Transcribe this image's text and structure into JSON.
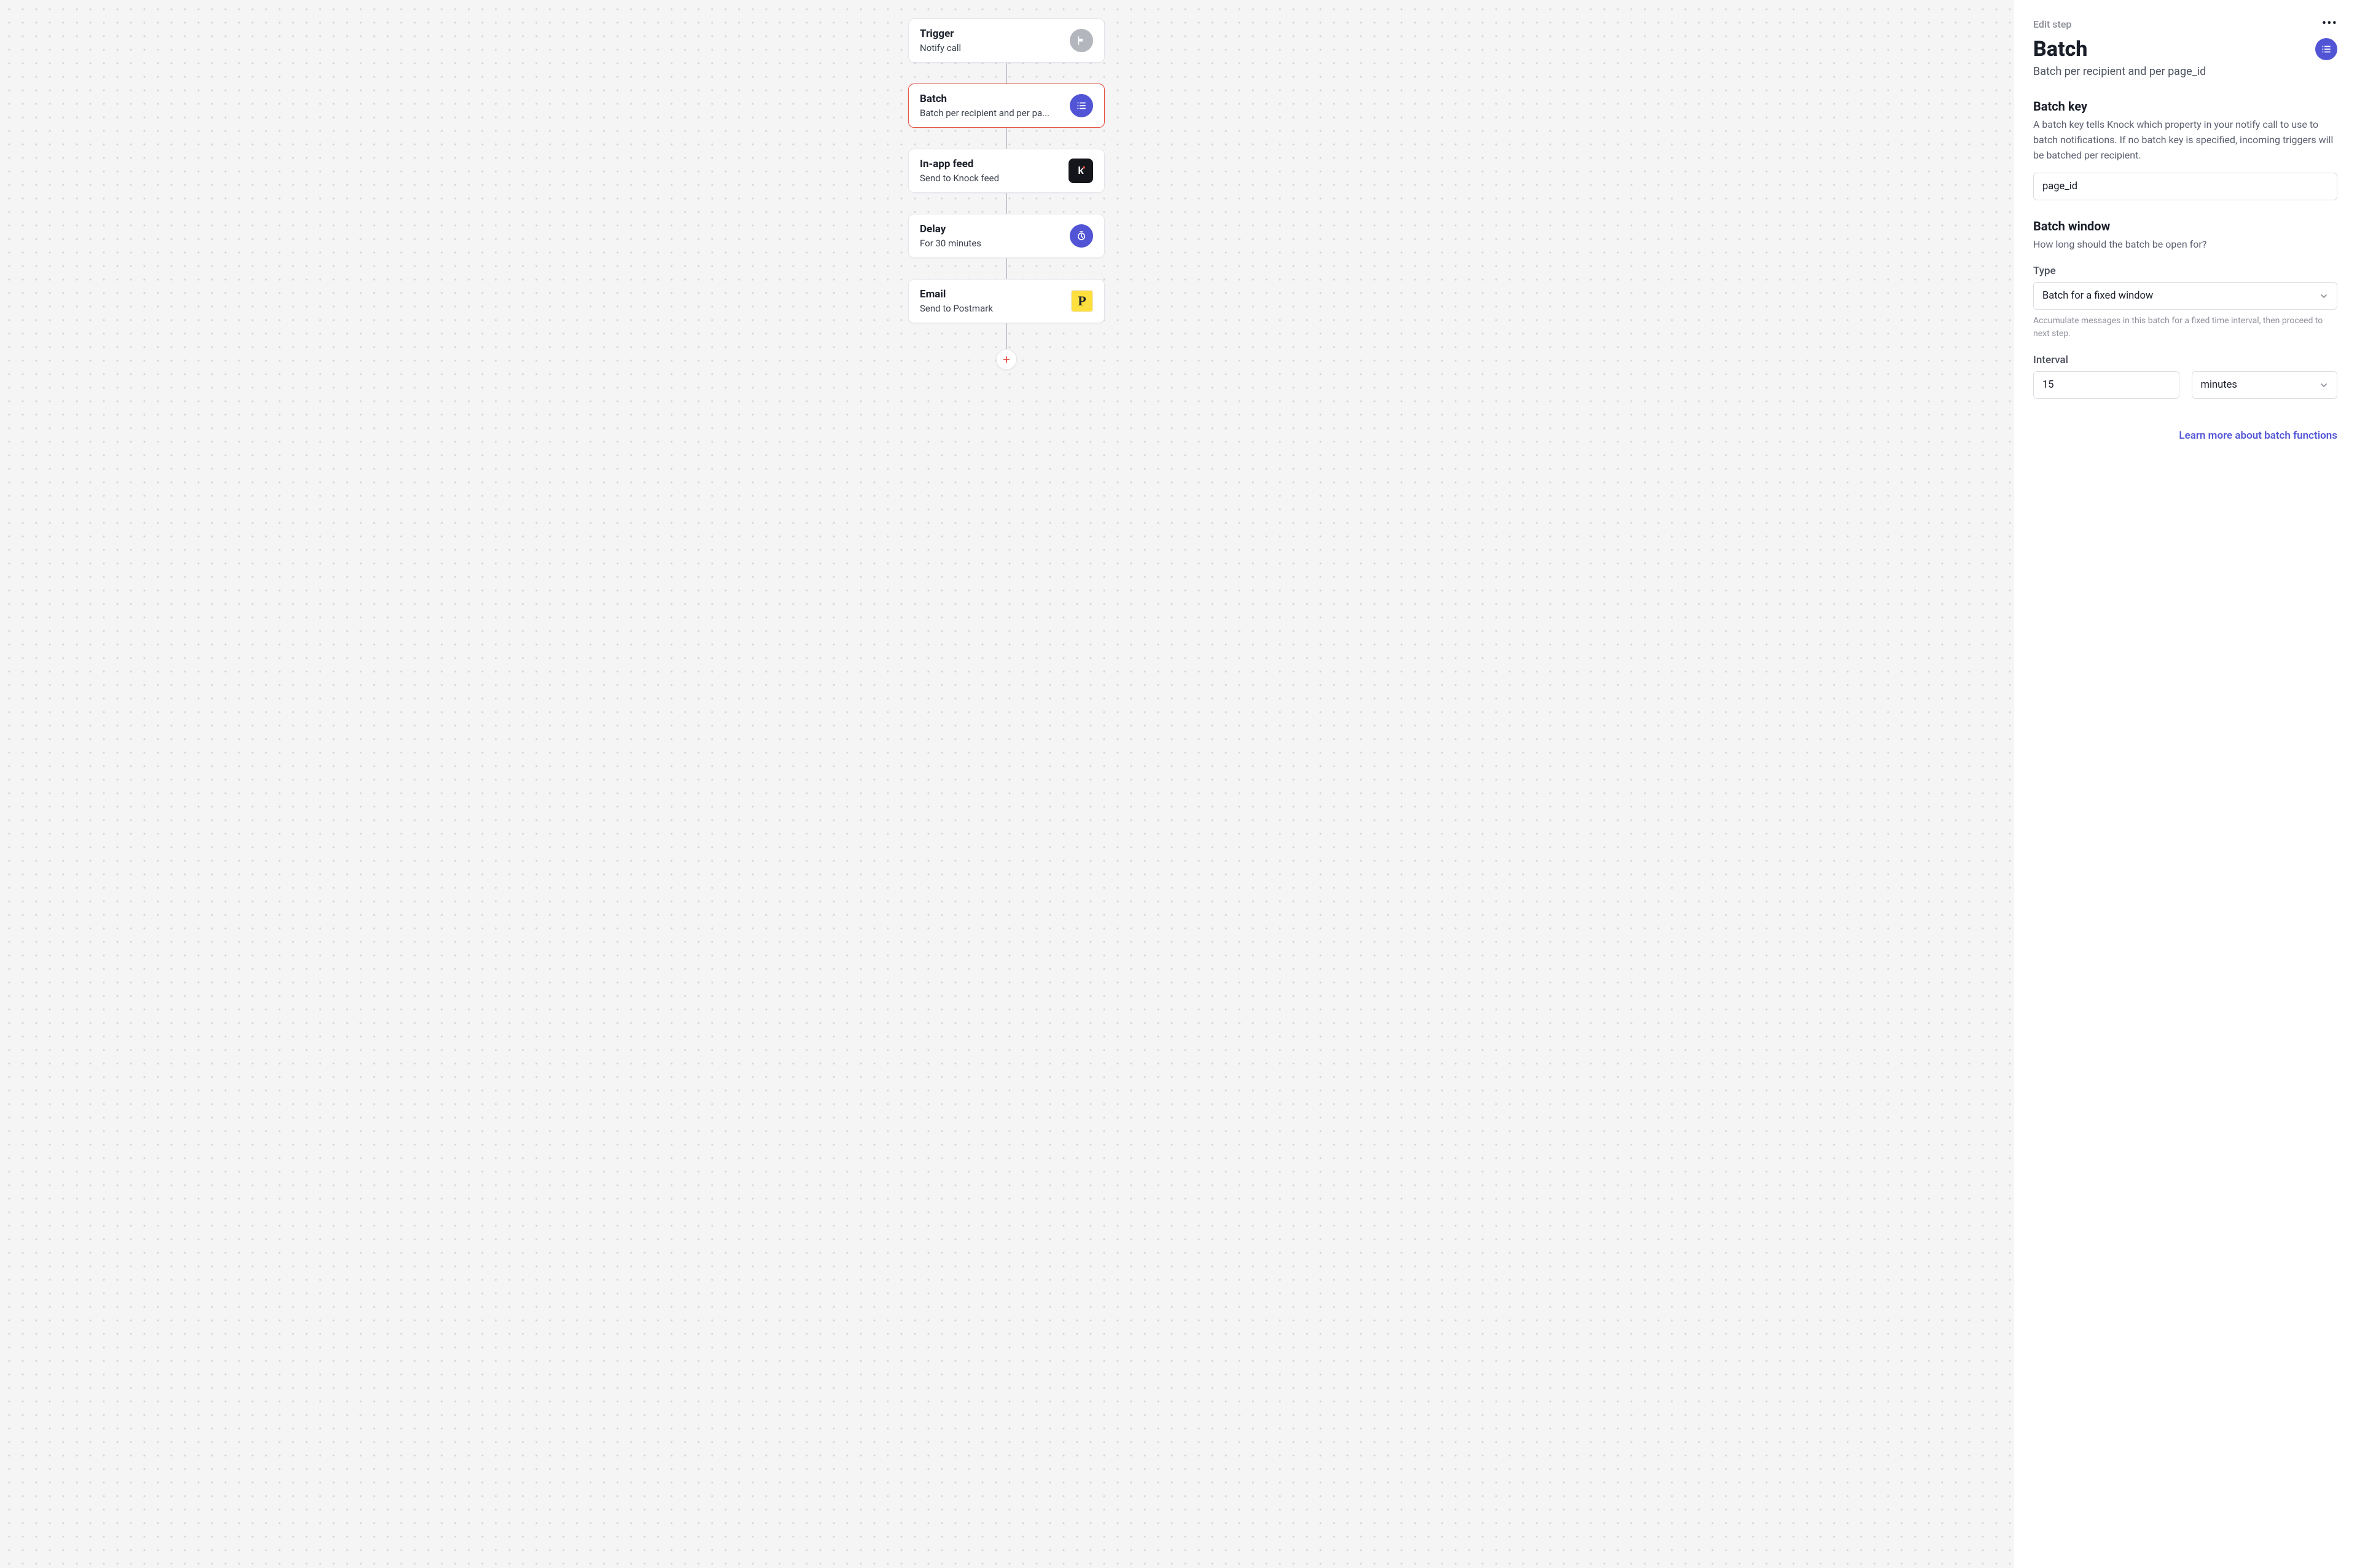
{
  "flow": {
    "nodes": [
      {
        "title": "Trigger",
        "subtitle": "Notify call",
        "icon": "flag",
        "selected": false
      },
      {
        "title": "Batch",
        "subtitle": "Batch per recipient and per pa...",
        "icon": "list",
        "selected": true
      },
      {
        "title": "In-app feed",
        "subtitle": "Send to Knock feed",
        "icon": "knock",
        "selected": false
      },
      {
        "title": "Delay",
        "subtitle": "For 30 minutes",
        "icon": "clock",
        "selected": false
      },
      {
        "title": "Email",
        "subtitle": "Send to Postmark",
        "icon": "postmark",
        "selected": false
      }
    ],
    "add_label": "+"
  },
  "panel": {
    "breadcrumb": "Edit step",
    "title": "Batch",
    "subtitle": "Batch per recipient and per page_id",
    "batch_key": {
      "heading": "Batch key",
      "description": "A batch key tells Knock which property in your notify call to use to batch notifications. If no batch key is specified, incoming triggers will be batched per recipient.",
      "value": "page_id"
    },
    "batch_window": {
      "heading": "Batch window",
      "description": "How long should the batch be open for?",
      "type_label": "Type",
      "type_value": "Batch for a fixed window",
      "type_help": "Accumulate messages in this batch for a fixed time interval, then proceed to next step.",
      "interval_label": "Interval",
      "interval_value": "15",
      "interval_unit": "minutes"
    },
    "learn_more": "Learn more about batch functions"
  }
}
